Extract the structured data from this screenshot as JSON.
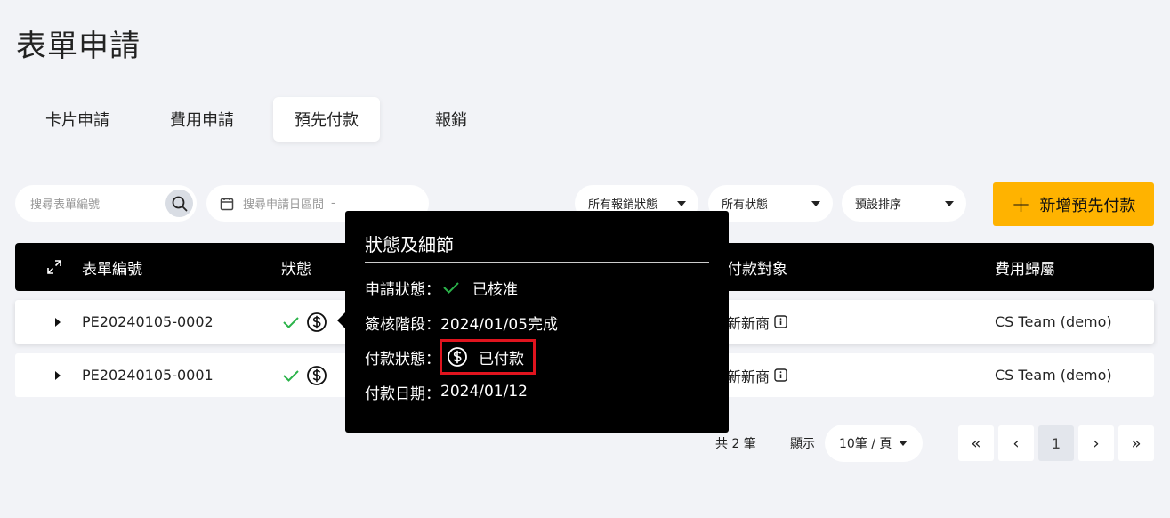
{
  "page_title": "表單申請",
  "tabs": [
    {
      "label": "卡片申請",
      "active": false
    },
    {
      "label": "費用申請",
      "active": false
    },
    {
      "label": "預先付款",
      "active": true
    },
    {
      "label": "報銷",
      "active": false
    }
  ],
  "filters": {
    "search_placeholder": "搜尋表單編號",
    "date_placeholder": "搜尋申請日區間",
    "date_separator": "-",
    "reimburse_status": "所有報銷狀態",
    "status": "所有狀態",
    "sort": "預設排序"
  },
  "add_button_label": "新增預先付款",
  "table": {
    "headers": {
      "form_no": "表單編號",
      "status": "狀態",
      "payee": "付款對象",
      "expense_owner": "費用歸屬"
    },
    "rows": [
      {
        "form_no": "PE20240105-0002",
        "payee": "新新商",
        "expense_owner": "CS Team (demo)"
      },
      {
        "form_no": "PE20240105-0001",
        "payee": "新新商",
        "expense_owner": "CS Team (demo)"
      }
    ]
  },
  "tooltip": {
    "title": "狀態及細節",
    "apply_status_label": "申請狀態：",
    "apply_status_value": "已核准",
    "stage_label": "簽核階段：",
    "stage_value": "2024/01/05完成",
    "payment_status_label": "付款狀態：",
    "payment_status_value": "已付款",
    "payment_date_label": "付款日期：",
    "payment_date_value": "2024/01/12"
  },
  "pagination": {
    "total_text": "共 2 筆",
    "show_label": "顯示",
    "page_size": "10筆 / 頁",
    "first": "«",
    "prev": "‹",
    "current_page": "1",
    "next": "›",
    "last": "»"
  },
  "colors": {
    "accent": "#ffb300",
    "approved_check": "#2bb34a",
    "highlight_border": "#e0141e",
    "header_bg": "#000000"
  }
}
